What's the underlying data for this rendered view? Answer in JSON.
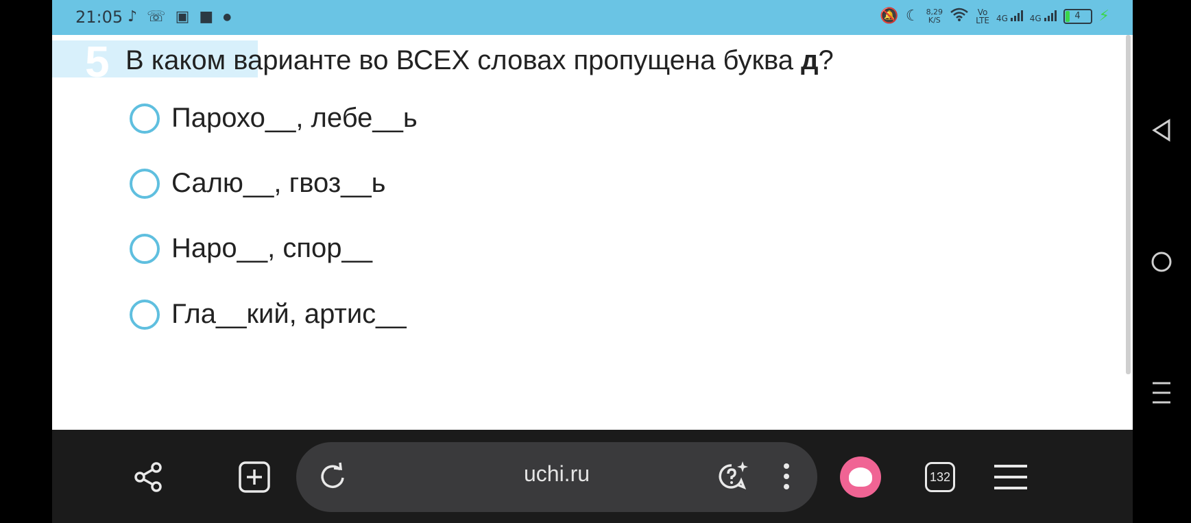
{
  "status_bar": {
    "time": "21:05",
    "left_icons": [
      "tiktok-icon",
      "missed-call-icon",
      "office-icon",
      "app-square-icon",
      "dot-icon"
    ],
    "net_speed_value": "8,29",
    "net_speed_unit": "K/S",
    "volte_top": "Vo",
    "volte_bottom": "LTE",
    "sim1": "4G",
    "sim2": "4G",
    "battery": "4"
  },
  "question": {
    "number": "5",
    "text_before": "В каком варианте во ВСЕХ словах пропущена буква ",
    "bold_letter": "д",
    "text_after": "?"
  },
  "options": [
    {
      "label": "Парохо__, лебе__ь"
    },
    {
      "label": "Салю__, гвоз__ь"
    },
    {
      "label": "Наро__, спор__"
    },
    {
      "label": "Гла__кий, артис__"
    }
  ],
  "browser": {
    "url": "uchi.ru",
    "tabs_count": "132"
  },
  "colors": {
    "status_bar": "#6ac4e4",
    "radio_border": "#5fbfdf",
    "question_highlight": "#d8f0fb",
    "alice": "#f06494"
  }
}
